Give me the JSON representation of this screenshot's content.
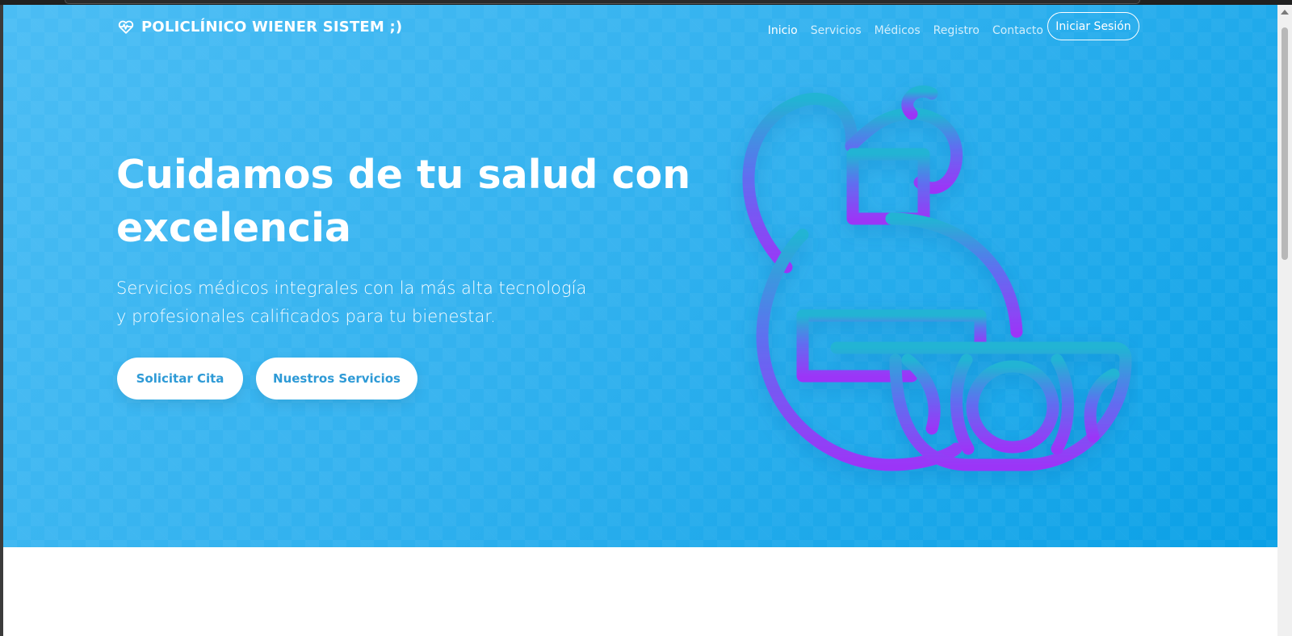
{
  "brand": {
    "name": "POLICLÍNICO WIENER SISTEM ;)",
    "icon": "heartbeat-icon"
  },
  "nav": {
    "links": [
      {
        "label": "Inicio",
        "active": true
      },
      {
        "label": "Servicios",
        "active": false
      },
      {
        "label": "Médicos",
        "active": false
      },
      {
        "label": "Registro",
        "active": false
      },
      {
        "label": "Contacto",
        "active": false
      }
    ],
    "login_label": "Iniciar Sesión"
  },
  "hero": {
    "title": "Cuidamos de tu salud con excelencia",
    "subtitle": "Servicios médicos integrales con la más alta tecnología y profesionales calificados para tu bienestar.",
    "primary_cta": "Solicitar Cita",
    "secondary_cta": "Nuestros Servicios",
    "illustration_icon": "medicine-bottle-and-bowl-icon"
  },
  "colors": {
    "hero_gradient_start": "#4bbdf4",
    "hero_gradient_end": "#0aa0e6",
    "illustration_top": "#23b3d6",
    "illustration_bottom": "#9b38f6",
    "cta_text": "#2e9ad6"
  }
}
